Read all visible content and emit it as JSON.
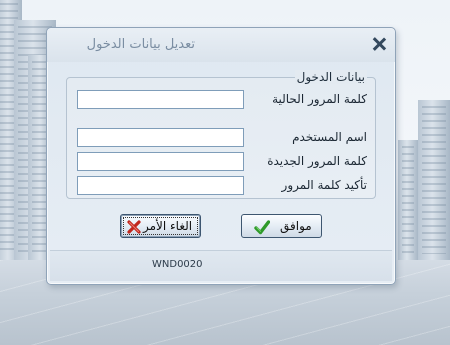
{
  "dialog": {
    "title": "تعديل بيانات الدخول",
    "group_label": "بيانات الدخول",
    "fields": [
      {
        "label": "كلمة المرور الحالية",
        "value": ""
      },
      {
        "label": "اسم المستخدم",
        "value": ""
      },
      {
        "label": "كلمة المرور الجديدة",
        "value": ""
      },
      {
        "label": "تأكيد كلمة المرور",
        "value": ""
      }
    ],
    "buttons": {
      "cancel_label": "الغاء الأمر",
      "ok_label": "موافق"
    },
    "status_code": "WND0020"
  },
  "icons": {
    "close": "close-icon",
    "cancel": "red-x-icon",
    "ok": "green-check-icon"
  },
  "colors": {
    "cancel_icon": "#c0271d",
    "ok_icon": "#2f9a2a"
  }
}
